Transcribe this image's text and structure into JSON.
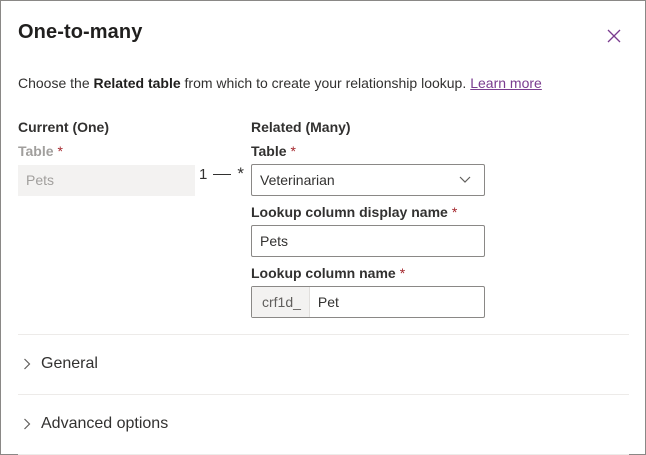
{
  "dialog": {
    "title": "One-to-many",
    "close_icon": "close-icon"
  },
  "description": {
    "prefix": "Choose the ",
    "bold": "Related table",
    "suffix": " from which to create your relationship lookup.",
    "link": "Learn more"
  },
  "current": {
    "heading": "Current (One)",
    "table_label": "Table",
    "required_mark": "*",
    "table_value": "Pets"
  },
  "cardinality": {
    "one": "1",
    "many": "*"
  },
  "related": {
    "heading": "Related (Many)",
    "table_label": "Table",
    "required_mark": "*",
    "table_value": "Veterinarian",
    "lookup_display_label": "Lookup column display name",
    "lookup_display_value": "Pets",
    "lookup_name_label": "Lookup column name",
    "lookup_name_prefix": "crf1d_",
    "lookup_name_value": "Pet"
  },
  "sections": {
    "general": "General",
    "advanced": "Advanced options"
  },
  "colors": {
    "link": "#7a3c8f",
    "required": "#a4262c",
    "close_icon": "#7a3c8f"
  }
}
